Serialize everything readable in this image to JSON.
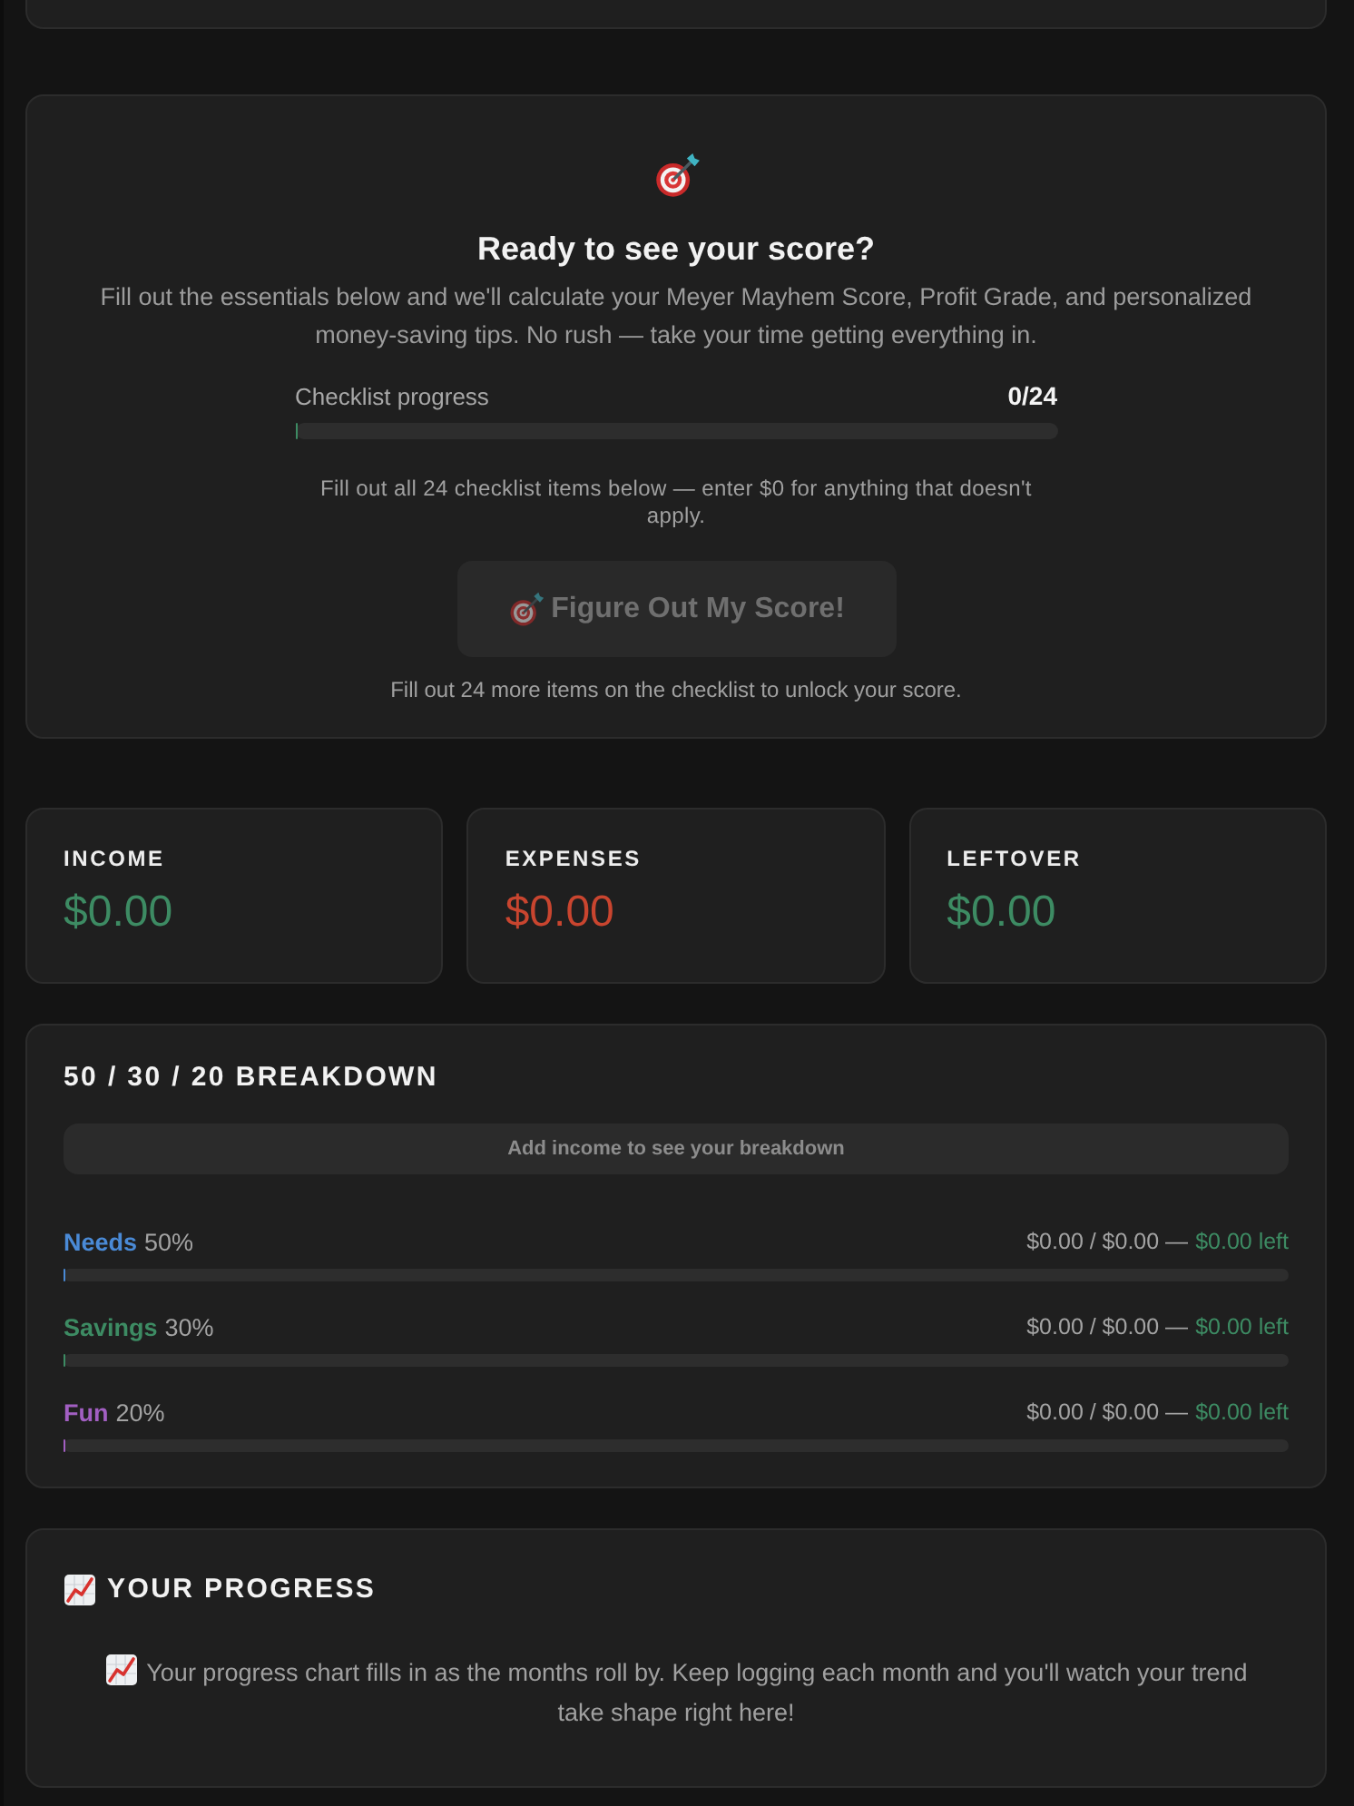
{
  "score_card": {
    "title": "Ready to see your score?",
    "description": "Fill out the essentials below and we'll calculate your Meyer Mayhem Score, Profit Grade, and personalized money-saving tips. No rush — take your time getting everything in.",
    "progress": {
      "label": "Checklist progress",
      "count": "0/24",
      "level": 0
    },
    "hint": "Fill out all 24 checklist items below — enter $0 for anything that doesn't apply.",
    "button": {
      "label": "Figure Out My Score!",
      "disabled": true
    },
    "footer": "Fill out 24 more items on the checklist to unlock your score."
  },
  "stats": [
    {
      "label": "INCOME",
      "value": "$0.00",
      "color": "#3d8b63"
    },
    {
      "label": "EXPENSES",
      "value": "$0.00",
      "color": "#c9452f"
    },
    {
      "label": "LEFTOVER",
      "value": "$0.00",
      "color": "#3d8b63"
    }
  ],
  "breakdown": {
    "title": "50 / 30 / 20 BREAKDOWN",
    "notice": "Add income to see your breakdown",
    "rows": [
      {
        "name": "Needs",
        "color": "#4a8ad6",
        "share": "50%",
        "amounts": "$0.00 / $0.00 —",
        "left": "$0.00 left",
        "level": 0
      },
      {
        "name": "Savings",
        "color": "#3d8b63",
        "share": "30%",
        "amounts": "$0.00 / $0.00 —",
        "left": "$0.00 left",
        "level": 0
      },
      {
        "name": "Fun",
        "color": "#a25fc2",
        "share": "20%",
        "amounts": "$0.00 / $0.00 —",
        "left": "$0.00 left",
        "level": 0
      }
    ]
  },
  "progress_section": {
    "title": "YOUR PROGRESS",
    "message": "Your progress chart fills in as the months roll by. Keep logging each month and you'll watch your trend take shape right here!"
  }
}
